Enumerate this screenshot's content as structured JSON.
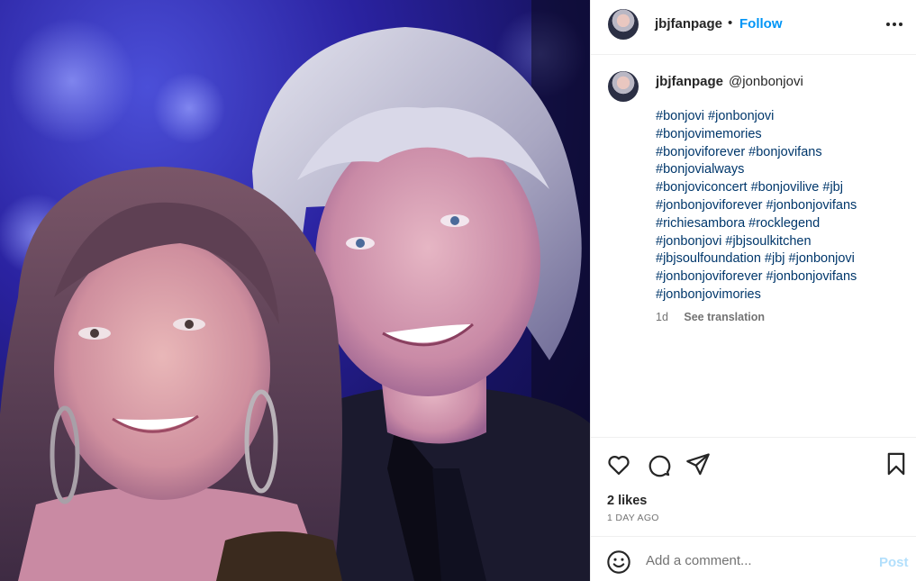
{
  "post": {
    "username": "jbjfanpage",
    "follow_label": "Follow",
    "separator": "•",
    "photo_alt": "Photo posted by jbjfanpage"
  },
  "caption": {
    "username": "jbjfanpage",
    "mention": "@jonbonjovi",
    "hashtag_lines": [
      "#bonjovi #jonbonjovi",
      "#bonjovimemories",
      "#bonjoviforever #bonjovifans",
      "#bonjovialways",
      "#bonjoviconcert #bonjovilive #jbj",
      "#jonbonjoviforever #jonbonjovifans",
      "#richiesambora #rocklegend",
      "#jonbonjovi #jbjsoulkitchen",
      "#jbjsoulfoundation #jbj #jonbonjovi",
      "#jonbonjoviforever #jonbonjovifans",
      "#jonbonjovimories"
    ],
    "time": "1d",
    "translate_label": "See translation"
  },
  "actions": {
    "icons": [
      "heart-icon",
      "comment-icon",
      "share-icon",
      "bookmark-icon"
    ],
    "likes": "2 likes",
    "posted": "1 DAY AGO"
  },
  "comment": {
    "placeholder": "Add a comment...",
    "post_label": "Post"
  },
  "colors": {
    "link": "#0095f6",
    "hashtag": "#00376b",
    "muted": "#737373",
    "post_disabled": "#b2dffc"
  }
}
